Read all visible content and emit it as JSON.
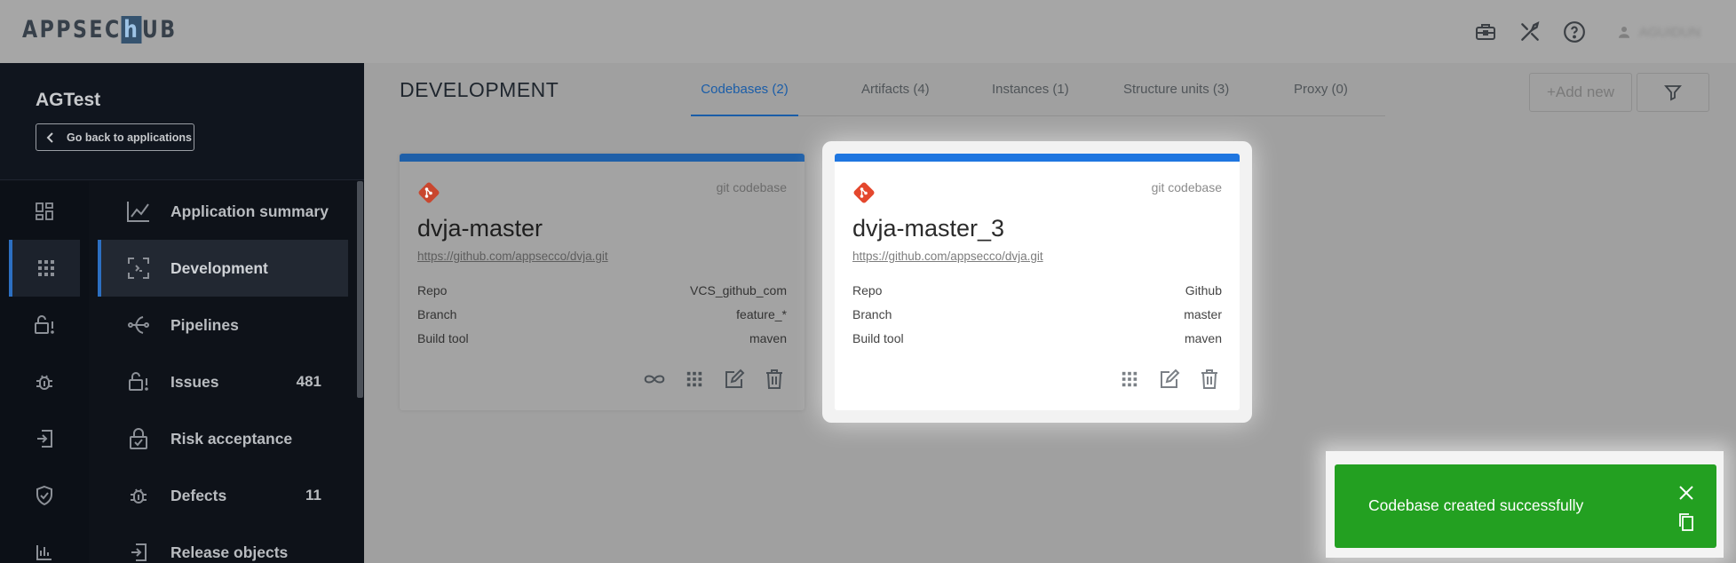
{
  "brand": {
    "logo_prefix": "APPSEC",
    "logo_h": "h",
    "logo_suffix": "UB"
  },
  "topbar": {
    "icons": [
      "briefcase-icon",
      "tools-icon",
      "help-icon",
      "user-icon"
    ],
    "user_name": "AGUIDUN"
  },
  "sidebar": {
    "app_title": "AGTest",
    "back_label": "Go back to applications",
    "rail_icons": [
      "dashboard-icon",
      "grid-icon",
      "lock-alert-icon",
      "bug-icon",
      "exit-icon",
      "shield-check-icon",
      "chart-icon"
    ],
    "items": [
      {
        "label": "Application summary",
        "icon": "chart-line-icon"
      },
      {
        "label": "Development",
        "icon": "scan-icon",
        "active": true
      },
      {
        "label": "Pipelines",
        "icon": "pipeline-icon"
      },
      {
        "label": "Issues",
        "icon": "lock-alert-icon",
        "count": "481"
      },
      {
        "label": "Risk acceptance",
        "icon": "lock-check-icon"
      },
      {
        "label": "Defects",
        "icon": "bug-icon",
        "count": "11"
      },
      {
        "label": "Release objects",
        "icon": "release-icon"
      }
    ]
  },
  "main": {
    "title": "DEVELOPMENT",
    "tabs": [
      {
        "label": "Codebases (2)",
        "active": true
      },
      {
        "label": "Artifacts (4)"
      },
      {
        "label": "Instances (1)"
      },
      {
        "label": "Structure units (3)"
      },
      {
        "label": "Proxy (0)"
      }
    ],
    "add_label": "+Add new",
    "cards": [
      {
        "type": "git codebase",
        "name": "dvja-master",
        "url": "https://github.com/appsecco/dvja.git",
        "rows": [
          {
            "k": "Repo",
            "v": "VCS_github_com"
          },
          {
            "k": "Branch",
            "v": "feature_*"
          },
          {
            "k": "Build tool",
            "v": "maven"
          }
        ]
      },
      {
        "type": "git codebase",
        "name": "dvja-master_3",
        "url": "https://github.com/appsecco/dvja.git",
        "rows": [
          {
            "k": "Repo",
            "v": "Github"
          },
          {
            "k": "Branch",
            "v": "master"
          },
          {
            "k": "Build tool",
            "v": "maven"
          }
        ]
      }
    ]
  },
  "toast": {
    "message": "Codebase created successfully"
  },
  "colors": {
    "accent": "#1f76e0",
    "success": "#23a021",
    "sidebar": "#0e1219",
    "git": "#e4472d"
  }
}
